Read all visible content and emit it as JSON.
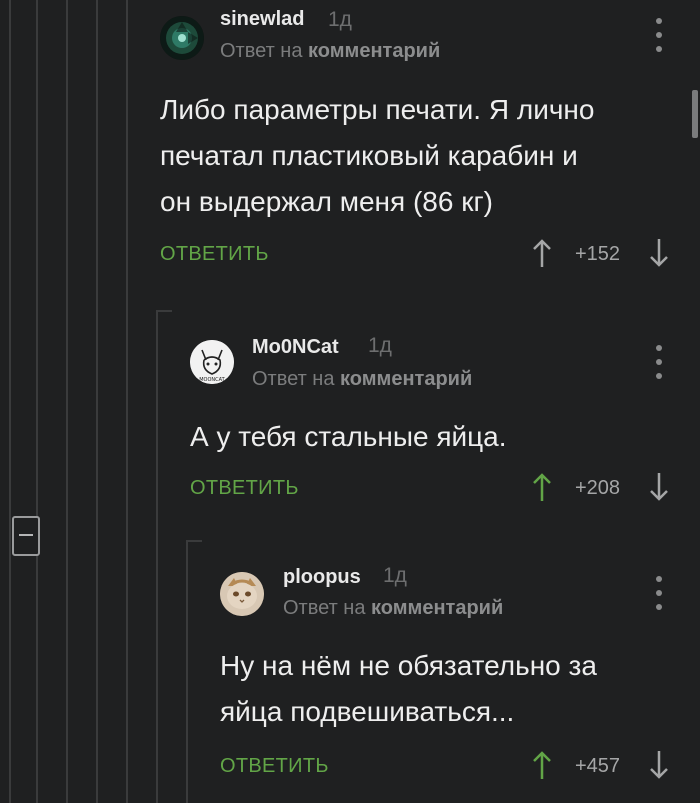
{
  "comments": [
    {
      "username": "sinewlad",
      "time": "1д",
      "reply_prefix": "Ответ на",
      "reply_target": "комментарий",
      "text_lines": [
        "Либо параметры печати. Я лично",
        "печатал пластиковый карабин и",
        "он выдержал меня (86 кг)"
      ],
      "reply_label": "ОТВЕТИТЬ",
      "rating": "+152",
      "upvoted": false,
      "avatar_icon": "aperture-avatar-icon"
    },
    {
      "username": "Mo0NCat",
      "time": "1д",
      "reply_prefix": "Ответ на",
      "reply_target": "комментарий",
      "text_lines": [
        "А у тебя стальные яйца."
      ],
      "reply_label": "ОТВЕТИТЬ",
      "rating": "+208",
      "upvoted": true,
      "avatar_icon": "cat-sketch-avatar-icon",
      "avatar_caption": "MOONCAT"
    },
    {
      "username": "ploopus",
      "time": "1д",
      "reply_prefix": "Ответ на",
      "reply_target": "комментарий",
      "text_lines": [
        "Ну на нём не обязательно за",
        "яйца подвешиваться..."
      ],
      "reply_label": "ОТВЕТИТЬ",
      "rating": "+457",
      "upvoted": true,
      "avatar_icon": "cat-photo-avatar-icon"
    }
  ],
  "colors": {
    "background": "#1f2021",
    "accent_green": "#62a547",
    "thread_line": "#3a3b3c"
  }
}
